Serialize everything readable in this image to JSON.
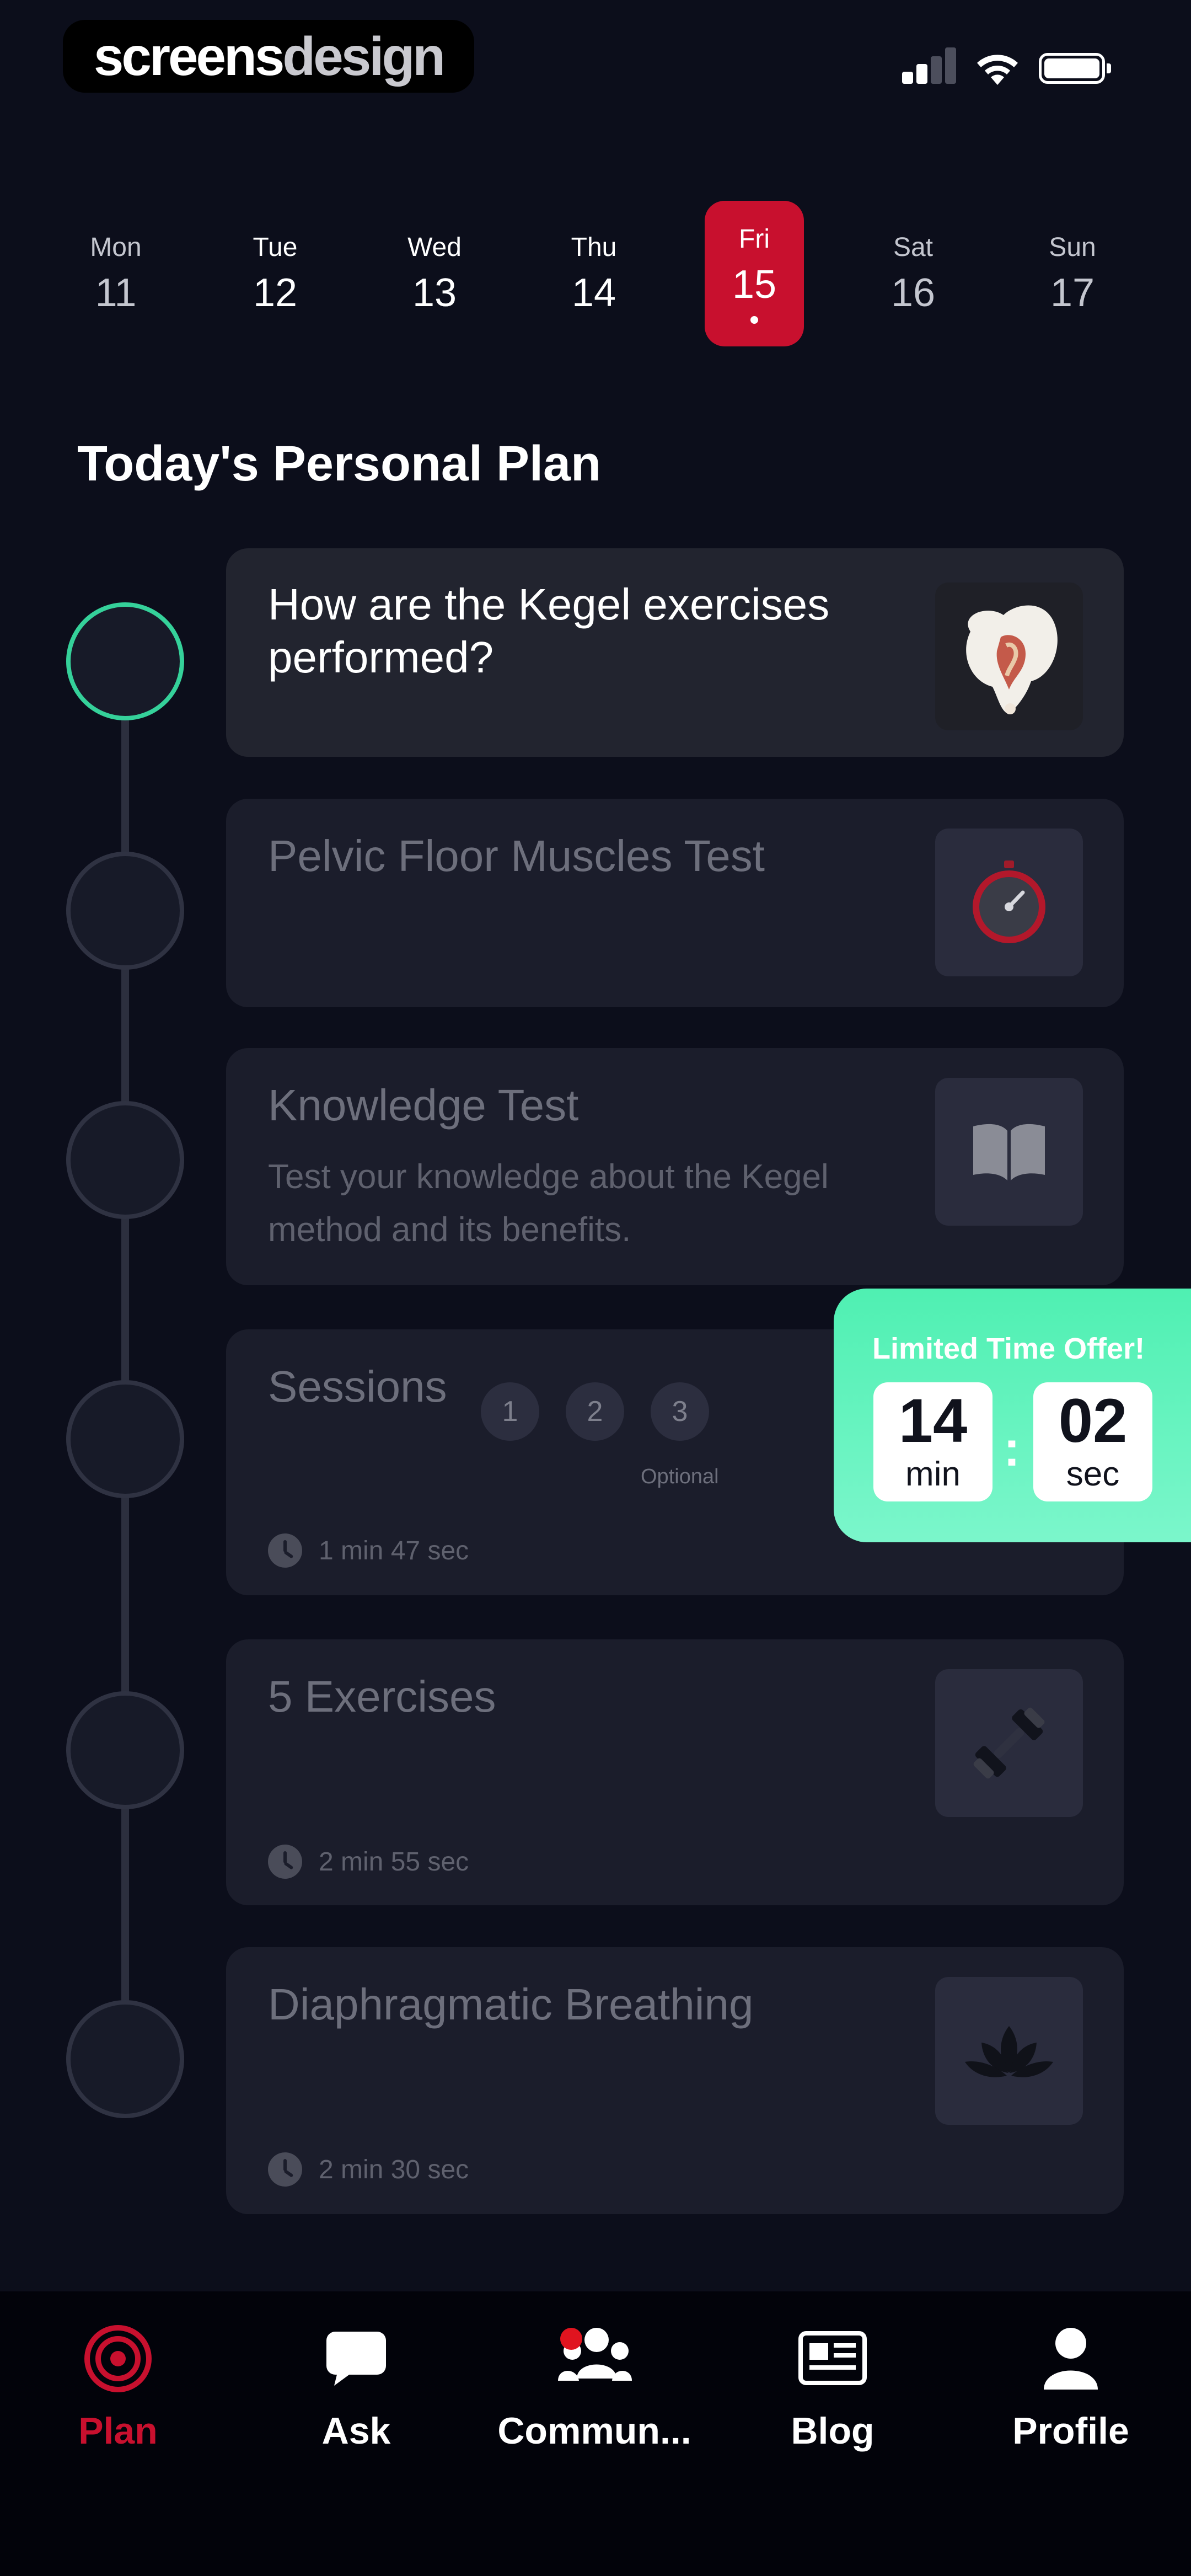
{
  "brand": {
    "part1": "screens",
    "part2": "design"
  },
  "week": [
    {
      "name": "Mon",
      "num": "11"
    },
    {
      "name": "Tue",
      "num": "12"
    },
    {
      "name": "Wed",
      "num": "13"
    },
    {
      "name": "Thu",
      "num": "14"
    },
    {
      "name": "Fri",
      "num": "15",
      "selected": true
    },
    {
      "name": "Sat",
      "num": "16"
    },
    {
      "name": "Sun",
      "num": "17"
    }
  ],
  "plan": {
    "title": "Today's Personal Plan",
    "items": [
      {
        "title": "How are the Kegel exercises performed?",
        "icon": "pelvis-icon",
        "completed_indicator": "active"
      },
      {
        "title": "Pelvic Floor Muscles Test",
        "icon": "stopwatch-icon"
      },
      {
        "title": "Knowledge Test",
        "description": "Test your knowledge about the Kegel method and its benefits.",
        "icon": "book-icon"
      },
      {
        "title": "Sessions",
        "sessions": [
          "1",
          "2",
          "3"
        ],
        "optional_label": "Optional",
        "duration": "1 min 47 sec"
      },
      {
        "title": "5 Exercises",
        "icon": "dumbbell-icon",
        "duration": "2 min 55 sec"
      },
      {
        "title": "Diaphragmatic  Breathing",
        "icon": "lotus-icon",
        "duration": "2 min 30 sec"
      }
    ]
  },
  "offer": {
    "title": "Limited Time Offer!",
    "minutes": "14",
    "minutes_unit": "min",
    "separator": ":",
    "seconds": "02",
    "seconds_unit": "sec"
  },
  "nav": [
    {
      "label": "Plan",
      "icon": "target-icon",
      "active": true
    },
    {
      "label": "Ask",
      "icon": "chat-bubble-icon"
    },
    {
      "label": "Commun...",
      "icon": "community-icon"
    },
    {
      "label": "Blog",
      "icon": "newspaper-icon"
    },
    {
      "label": "Profile",
      "icon": "person-icon"
    }
  ],
  "colors": {
    "accent": "#c8102e",
    "success": "#35d19a",
    "offer": "#4ff0b2",
    "background": "#0c0e1b"
  }
}
